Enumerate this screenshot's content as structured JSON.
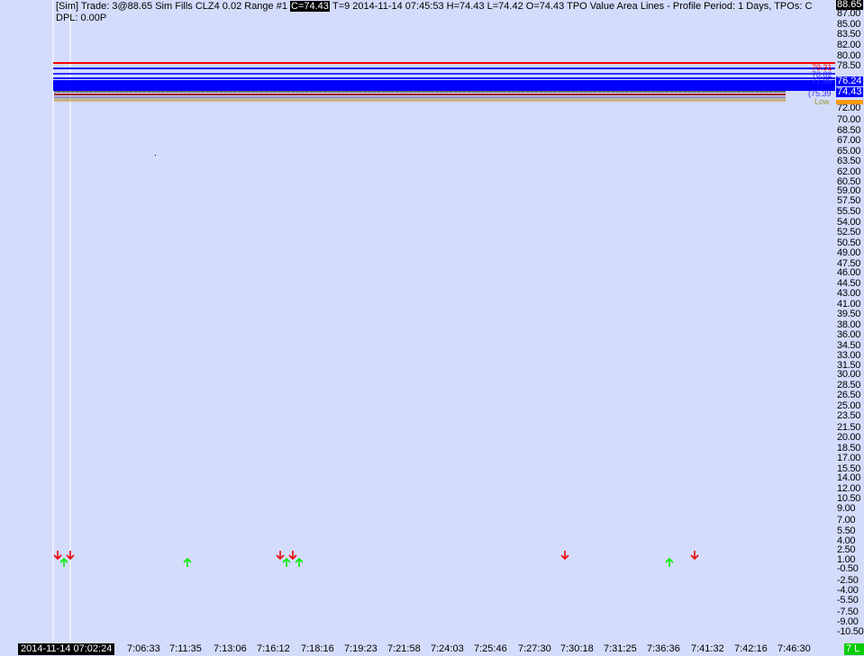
{
  "header": {
    "prefix": "[Sim]  Trade: 3@88.65 Sim Fills  CLZ4  0.02 Range  #1",
    "close": "C=74.43",
    "rest": "T=9 2014-11-14 07:45:53 H=74.43 L=74.42 O=74.43  TPO Value Area Lines - Profile Period: 1 Days, TPOs: C",
    "dpl": "DPL: 0.00P"
  },
  "y_axis": {
    "top_tag": "88.65",
    "ticks": [
      "87.00",
      "85.00",
      "83.50",
      "82.00",
      "80.00",
      "78.50",
      "72.00",
      "70.00",
      "68.50",
      "67.00",
      "65.00",
      "63.50",
      "62.00",
      "60.50",
      "59.00",
      "57.50",
      "55.50",
      "54.00",
      "52.50",
      "50.50",
      "49.00",
      "47.50",
      "46.00",
      "44.50",
      "43.00",
      "41.00",
      "39.50",
      "38.00",
      "36.00",
      "34.50",
      "33.00",
      "31.50",
      "30.00",
      "28.50",
      "26.50",
      "25.00",
      "23.50",
      "21.50",
      "20.00",
      "18.50",
      "17.00",
      "15.50",
      "14.00",
      "12.00",
      "10.50",
      "9.00",
      "7.00",
      "5.50",
      "4.00",
      "2.50",
      "1.00",
      "-0.50",
      "-2.50",
      "-4.00",
      "-5.50",
      "-7.50",
      "-9.00",
      "-10.50"
    ],
    "tag_7624": "76.24",
    "tag_7443": "74.43"
  },
  "levels": {
    "l1": "79.31",
    "l2": "78.82",
    "l3": "77.96",
    "l4": "(75.39",
    "low": "Low"
  },
  "x_axis": {
    "start": "2014-11-14  07:02:24",
    "ticks": [
      "7:06:33",
      "7:11:35",
      "7:13:06",
      "7:16:12",
      "7:18:16",
      "7:19:23",
      "7:21:58",
      "7:24:03",
      "7:25:46",
      "7:27:30",
      "7:30:18",
      "7:31:25",
      "7:36:36",
      "7:41:32",
      "7:42:16",
      "7:46:30"
    ],
    "corner": "7 L"
  },
  "colors": {
    "background": "#d4dcfc",
    "buy_arrow": "#00ee00",
    "sell_arrow": "#ee0000",
    "value_area": "#0000ff"
  }
}
